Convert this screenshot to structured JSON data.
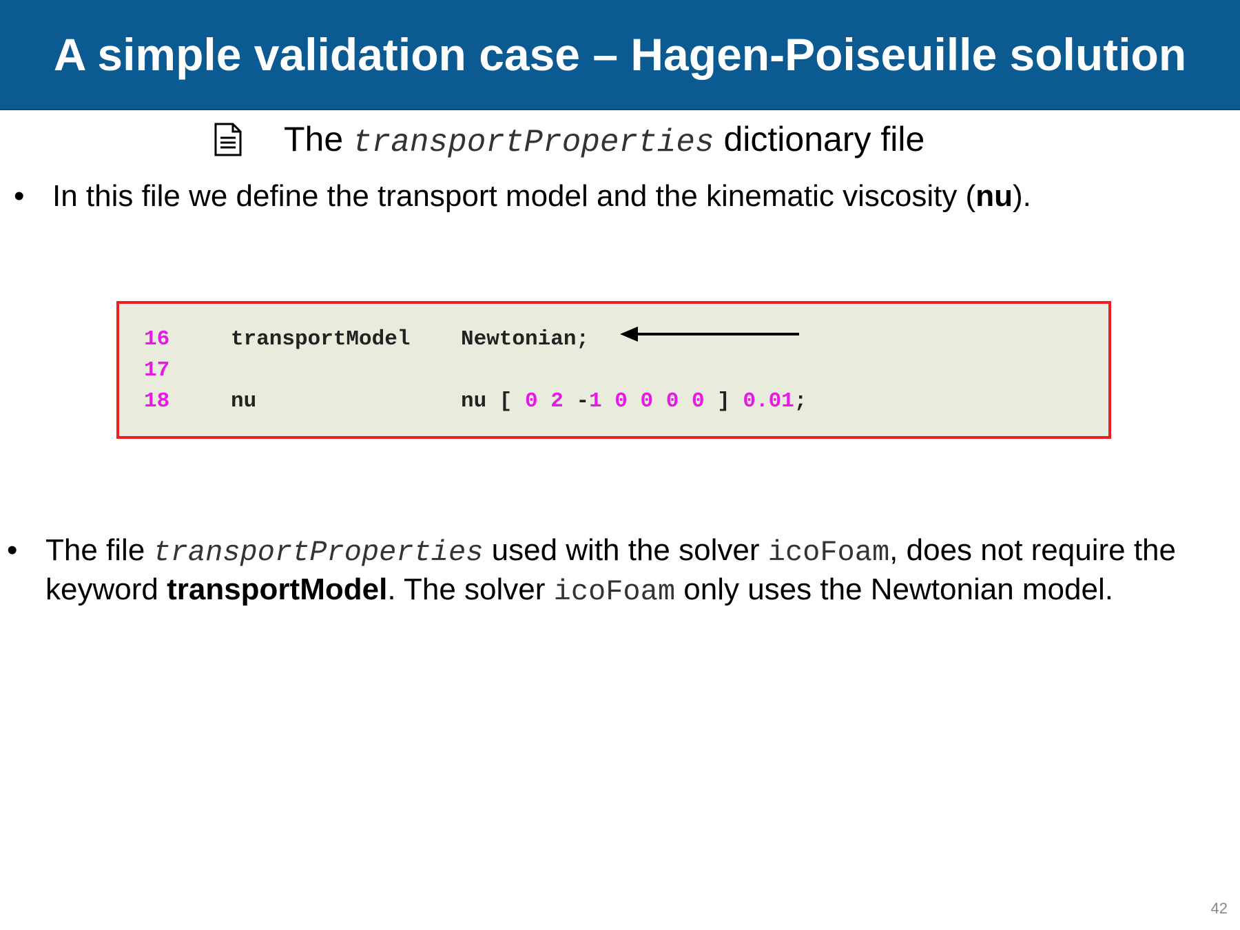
{
  "slide": {
    "title": "A simple validation case – Hagen-Poiseuille solution",
    "page_number": "42"
  },
  "subtitle": {
    "icon": "document-icon",
    "prefix": "The",
    "file_name": "transportProperties",
    "suffix": "dictionary file"
  },
  "bullet1": {
    "text_before": "In this file we define the transport model and the kinematic viscosity (",
    "bold": "nu",
    "text_after": ")."
  },
  "code": {
    "border_color": "#ee1c24",
    "background": "#e9ecdd",
    "lines": [
      {
        "number": "16",
        "keyword": "transportModel",
        "value": "Newtonian;"
      },
      {
        "number": "17",
        "keyword": "",
        "value": ""
      },
      {
        "number": "18",
        "keyword": "nu",
        "value_prefix": "nu [ ",
        "dims": [
          "0",
          "2",
          "-",
          "1",
          "0",
          "0",
          "0",
          "0"
        ],
        "value_close": " ] ",
        "scalar": "0.01",
        "terminator": ";"
      }
    ]
  },
  "bullet2": {
    "t1": "The file ",
    "file_name": "transportProperties",
    "t2": " used with the solver ",
    "solver": "icoFoam",
    "t3": ", does not require the keyword ",
    "bold": "transportModel",
    "t4": ".  The solver ",
    "solver2": "icoFoam",
    "t5": " only uses the Newtonian model."
  }
}
